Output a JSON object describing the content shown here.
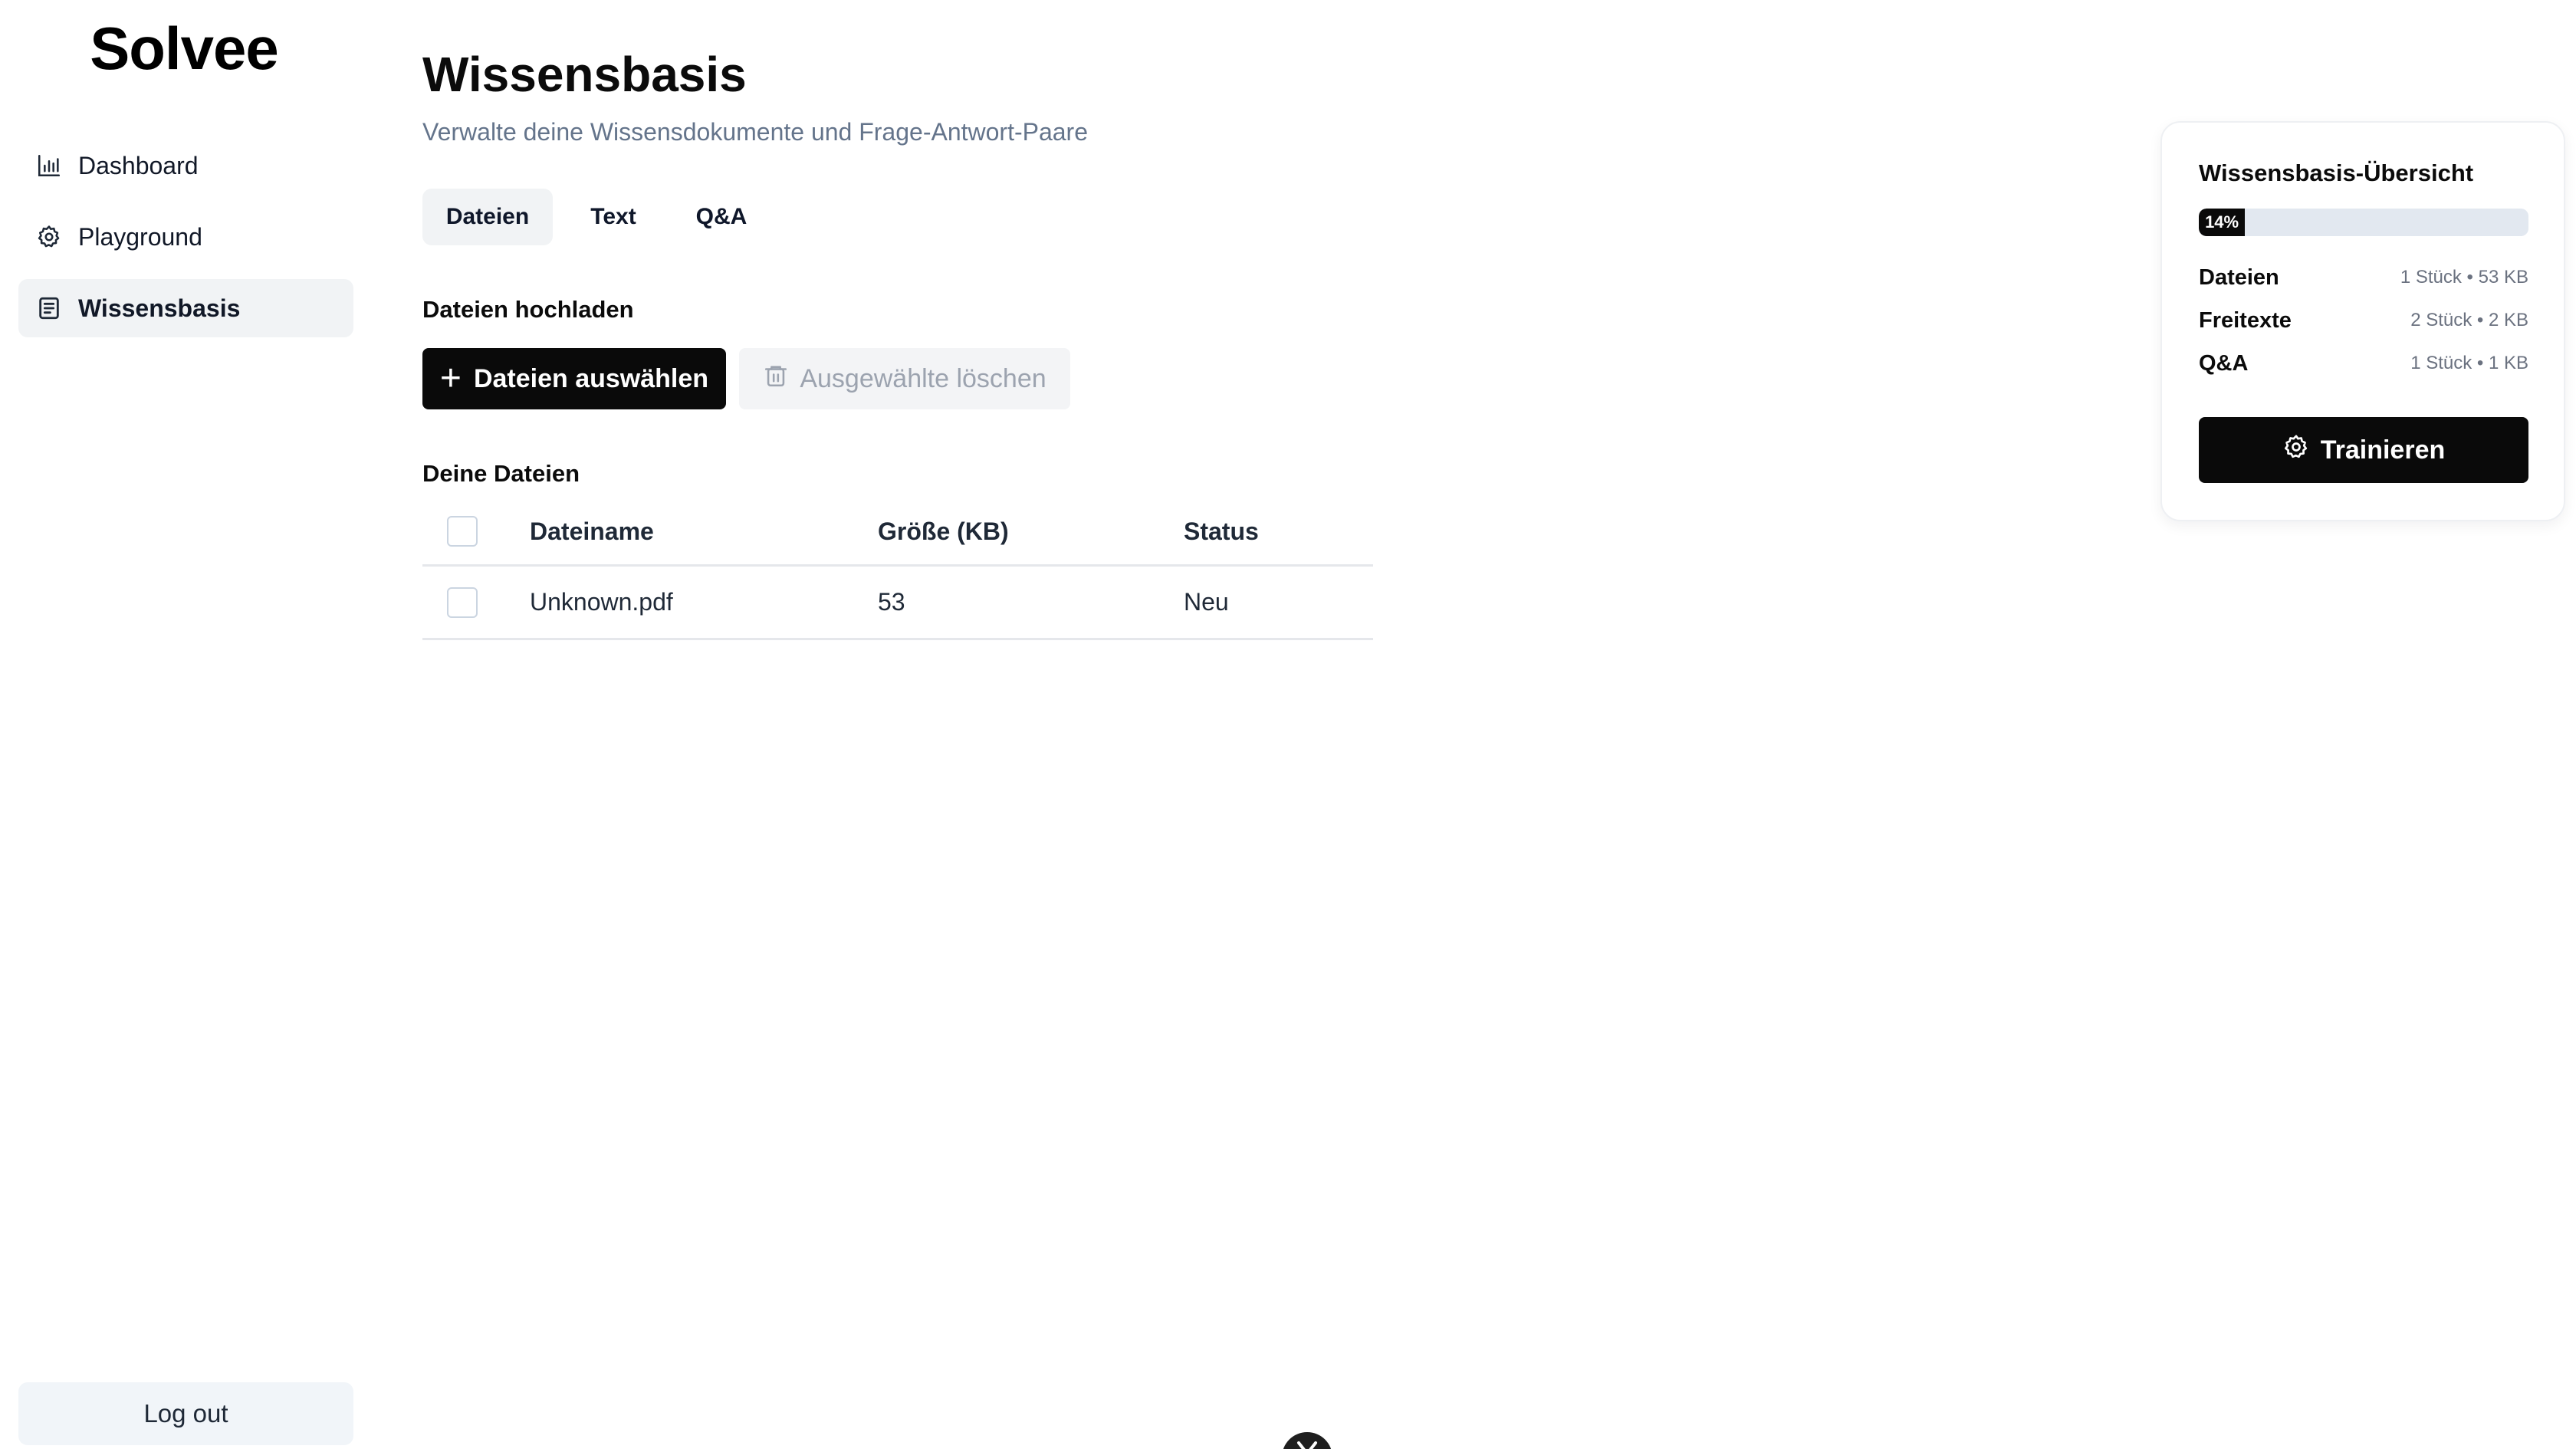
{
  "brand": {
    "name": "Solvee"
  },
  "sidebar": {
    "items": [
      {
        "label": "Dashboard",
        "icon": "bar-chart-icon",
        "active": false
      },
      {
        "label": "Playground",
        "icon": "gear-icon",
        "active": false
      },
      {
        "label": "Wissensbasis",
        "icon": "document-icon",
        "active": true
      }
    ],
    "logout_label": "Log out"
  },
  "page": {
    "title": "Wissensbasis",
    "subtitle": "Verwalte deine Wissensdokumente und Frage-Antwort-Paare"
  },
  "tabs": [
    {
      "label": "Dateien",
      "active": true
    },
    {
      "label": "Text",
      "active": false
    },
    {
      "label": "Q&A",
      "active": false
    }
  ],
  "upload": {
    "heading": "Dateien hochladen",
    "select_button": "Dateien auswählen",
    "delete_button": "Ausgewählte löschen"
  },
  "files": {
    "heading": "Deine Dateien",
    "columns": [
      "Dateiname",
      "Größe (KB)",
      "Status"
    ],
    "rows": [
      {
        "name": "Unknown.pdf",
        "size": "53",
        "status": "Neu"
      }
    ]
  },
  "overview": {
    "title": "Wissensbasis-Übersicht",
    "progress_percent": 14,
    "progress_label": "14%",
    "stats": [
      {
        "label": "Dateien",
        "value": "1 Stück • 53 KB"
      },
      {
        "label": "Freitexte",
        "value": "2 Stück • 2 KB"
      },
      {
        "label": "Q&A",
        "value": "1 Stück • 1 KB"
      }
    ],
    "train_button": "Trainieren"
  },
  "colors": {
    "primary": "#0a0a0a",
    "muted_text": "#64748b",
    "active_bg": "#f1f3f5",
    "progress_track": "#e2e8f0"
  }
}
